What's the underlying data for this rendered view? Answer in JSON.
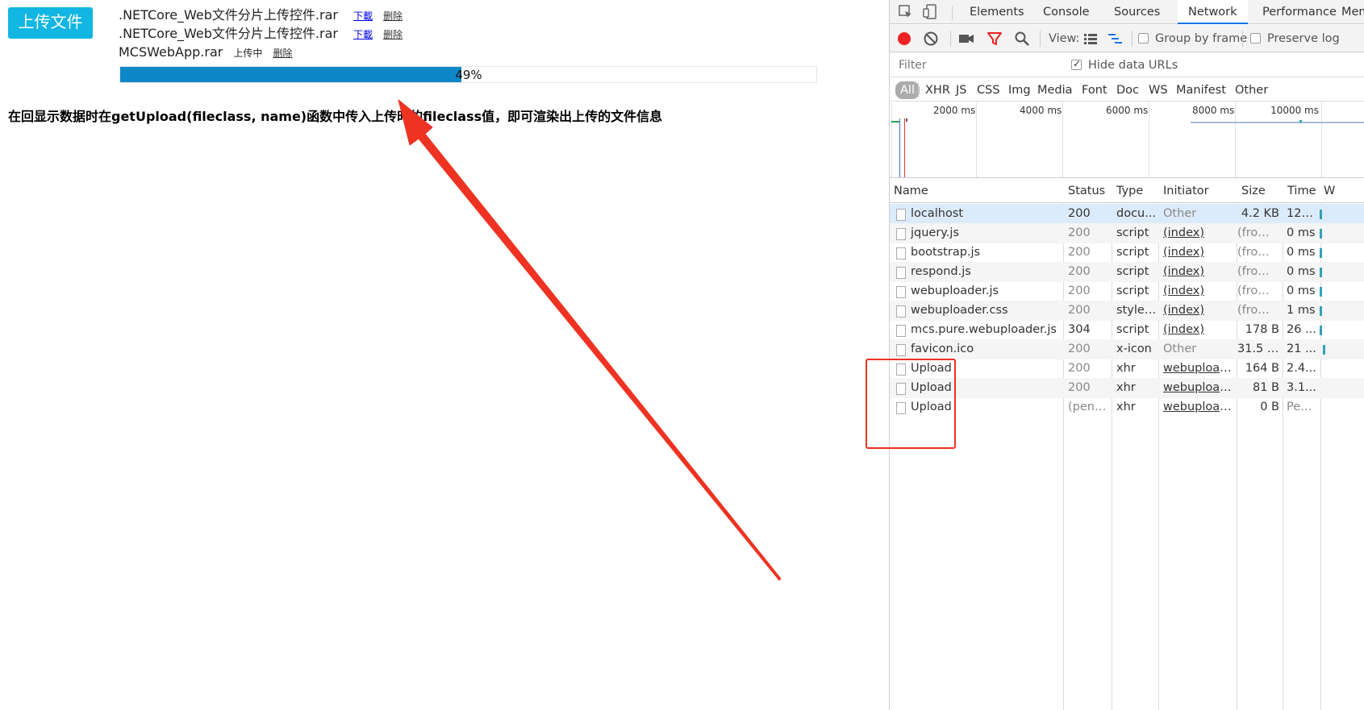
{
  "page": {
    "upload_button": "上传文件",
    "files": [
      {
        "name": ".NETCore_Web文件分片上传控件.rar",
        "download": "下載",
        "delete": "删除"
      },
      {
        "name": ".NETCore_Web文件分片上传控件.rar",
        "download": "下載",
        "delete": "删除"
      },
      {
        "name": "MCSWebApp.rar",
        "status": "上传中",
        "delete": "删除"
      }
    ],
    "progress_percent": 49,
    "progress_label": "49%",
    "note": "在回显示数据时在getUpload(fileclass, name)函数中传入上传时的fileclass值，即可渲染出上传的文件信息",
    "arrow_color": "#ee3322"
  },
  "devtools": {
    "tabs": [
      "Elements",
      "Console",
      "Sources",
      "Network",
      "Performance",
      "Mem"
    ],
    "active_tab": "Network",
    "toolbar": {
      "view_label": "View:",
      "group_by_frame": "Group by frame",
      "preserve_log": "Preserve log"
    },
    "filter_placeholder": "Filter",
    "hide_data_urls": "Hide data URLs",
    "types": [
      "All",
      "XHR",
      "JS",
      "CSS",
      "Img",
      "Media",
      "Font",
      "Doc",
      "WS",
      "Manifest",
      "Other"
    ],
    "overview_ticks": [
      "2000 ms",
      "4000 ms",
      "6000 ms",
      "8000 ms",
      "10000 ms"
    ],
    "columns": [
      "Name",
      "Status",
      "Type",
      "Initiator",
      "Size",
      "Time",
      "W"
    ],
    "rows": [
      {
        "name": "localhost",
        "status": "200",
        "type": "docu...",
        "initiator": "Other",
        "size": "4.2 KB",
        "time": "121..."
      },
      {
        "name": "jquery.js",
        "status": "200",
        "type": "script",
        "initiator": "(index)",
        "size": "(from...",
        "time": "0 ms"
      },
      {
        "name": "bootstrap.js",
        "status": "200",
        "type": "script",
        "initiator": "(index)",
        "size": "(from...",
        "time": "0 ms"
      },
      {
        "name": "respond.js",
        "status": "200",
        "type": "script",
        "initiator": "(index)",
        "size": "(from...",
        "time": "0 ms"
      },
      {
        "name": "webuploader.js",
        "status": "200",
        "type": "script",
        "initiator": "(index)",
        "size": "(from...",
        "time": "0 ms"
      },
      {
        "name": "webuploader.css",
        "status": "200",
        "type": "styles...",
        "initiator": "(index)",
        "size": "(from...",
        "time": "1 ms"
      },
      {
        "name": "mcs.pure.webuploader.js",
        "status": "304",
        "type": "script",
        "initiator": "(index)",
        "size": "178 B",
        "time": "26 ..."
      },
      {
        "name": "favicon.ico",
        "status": "200",
        "type": "x-icon",
        "initiator": "Other",
        "size": "31.5 KB",
        "time": "21 ..."
      },
      {
        "name": "Upload",
        "status": "200",
        "type": "xhr",
        "initiator": "webuploade...",
        "size": "164 B",
        "time": "2.4..."
      },
      {
        "name": "Upload",
        "status": "200",
        "type": "xhr",
        "initiator": "webuploade...",
        "size": "81 B",
        "time": "3.1..."
      },
      {
        "name": "Upload",
        "status": "(pend...",
        "type": "xhr",
        "initiator": "webuploade...",
        "size": "0 B",
        "time": "Pen..."
      }
    ],
    "highlight_color": "#ee3322"
  }
}
